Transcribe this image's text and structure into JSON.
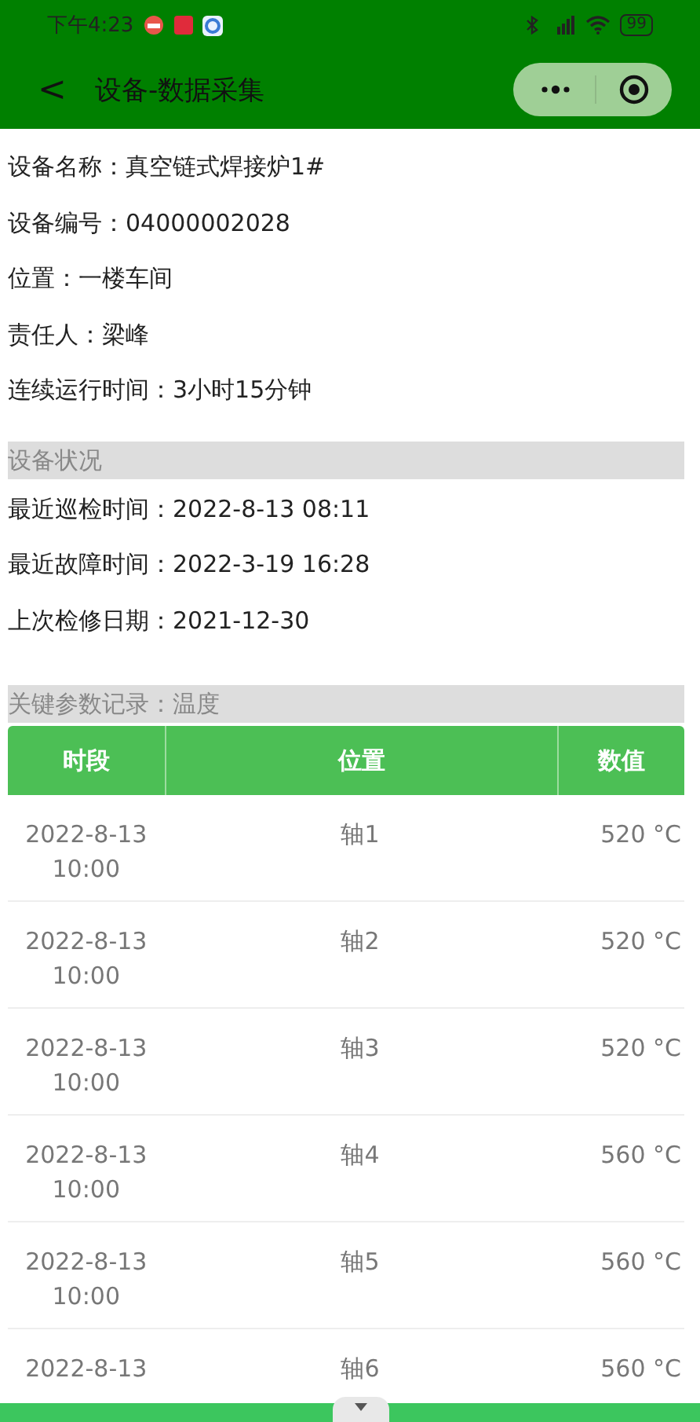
{
  "status_bar": {
    "time": "下午4:23",
    "battery": "99"
  },
  "nav_bar": {
    "back": "<",
    "title": "设备-数据采集"
  },
  "device_info": [
    {
      "label": "设备名称：",
      "value": "真空链式焊接炉1#"
    },
    {
      "label": "设备编号：",
      "value": "04000002028"
    },
    {
      "label": "位置：",
      "value": "一楼车间"
    },
    {
      "label": "责任人：",
      "value": "梁峰"
    },
    {
      "label": "连续运行时间：",
      "value": "3小时15分钟"
    }
  ],
  "status_section": {
    "title": "设备状况",
    "items": [
      {
        "label": "最近巡检时间：",
        "value": "2022-8-13 08:11"
      },
      {
        "label": "最近故障时间：",
        "value": "2022-3-19 16:28"
      },
      {
        "label": "上次检修日期：",
        "value": "2021-12-30"
      }
    ]
  },
  "records": {
    "title": "关键参数记录：温度",
    "table": {
      "columns": [
        "时段",
        "位置",
        "数值"
      ],
      "rows": [
        [
          "2022-8-13\n10:00",
          "轴1",
          "520 °C"
        ],
        [
          "2022-8-13\n10:00",
          "轴2",
          "520 °C"
        ],
        [
          "2022-8-13\n10:00",
          "轴3",
          "520 °C"
        ],
        [
          "2022-8-13\n10:00",
          "轴4",
          "560 °C"
        ],
        [
          "2022-8-13\n10:00",
          "轴5",
          "560 °C"
        ],
        [
          "2022-8-13",
          "轴6",
          "560 °C"
        ]
      ]
    }
  }
}
